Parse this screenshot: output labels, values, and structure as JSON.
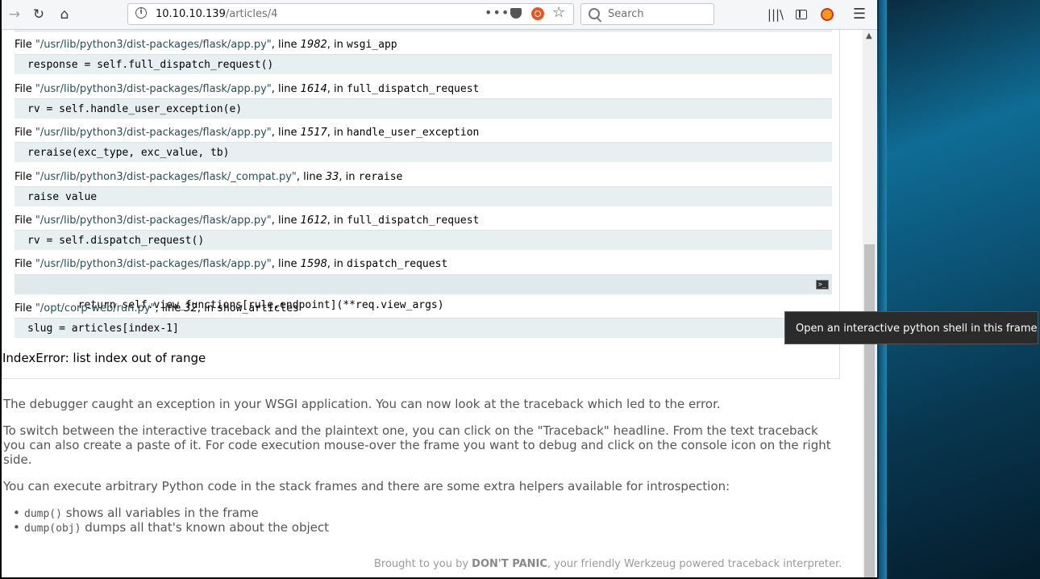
{
  "toolbar": {
    "url_host": "10.10.10.139",
    "url_path": "/articles/4",
    "more_label": "•••",
    "search_placeholder": "Search"
  },
  "frames": [
    {
      "prefix": "File ",
      "file": "\"/usr/lib/python3/dist-packages/flask/app.py\"",
      "mid": ", line ",
      "line": "1982",
      "post": ", in ",
      "func": "wsgi_app",
      "code": "response = self.full_dispatch_request()"
    },
    {
      "prefix": "File ",
      "file": "\"/usr/lib/python3/dist-packages/flask/app.py\"",
      "mid": ", line ",
      "line": "1614",
      "post": ", in ",
      "func": "full_dispatch_request",
      "code": "rv = self.handle_user_exception(e)"
    },
    {
      "prefix": "File ",
      "file": "\"/usr/lib/python3/dist-packages/flask/app.py\"",
      "mid": ", line ",
      "line": "1517",
      "post": ", in ",
      "func": "handle_user_exception",
      "code": "reraise(exc_type, exc_value, tb)"
    },
    {
      "prefix": "File ",
      "file": "\"/usr/lib/python3/dist-packages/flask/_compat.py\"",
      "mid": ", line ",
      "line": "33",
      "post": ", in ",
      "func": "reraise",
      "code": "raise value"
    },
    {
      "prefix": "File ",
      "file": "\"/usr/lib/python3/dist-packages/flask/app.py\"",
      "mid": ", line ",
      "line": "1612",
      "post": ", in ",
      "func": "full_dispatch_request",
      "code": "rv = self.dispatch_request()"
    },
    {
      "prefix": "File ",
      "file": "\"/usr/lib/python3/dist-packages/flask/app.py\"",
      "mid": ", line ",
      "line": "1598",
      "post": ", in ",
      "func": "dispatch_request",
      "code": "return self.view_functions[rule.endpoint](**req.view_args)"
    },
    {
      "prefix": "File ",
      "file": "\"/opt/corp-web/run.py\"",
      "mid": ", line ",
      "line": "32",
      "post": ", in ",
      "func": "show_articles",
      "code": "slug = articles[index-1]"
    }
  ],
  "console_icon": ">_",
  "exception": "IndexError: list index out of range",
  "explanation": {
    "p1": "The debugger caught an exception in your WSGI application. You can now look at the traceback which led to the error.",
    "p2": "To switch between the interactive traceback and the plaintext one, you can click on the \"Traceback\" headline. From the text traceback you can also create a paste of it. For code execution mouse-over the frame you want to debug and click on the console icon on the right side.",
    "p3": "You can execute arbitrary Python code in the stack frames and there are some extra helpers available for introspection:",
    "bullets": [
      {
        "code": "dump()",
        "text": " shows all variables in the frame"
      },
      {
        "code": "dump(obj)",
        "text": " dumps all that's known about the object"
      }
    ]
  },
  "footer": {
    "pre": "Brought to you by ",
    "brand": "DON'T PANIC",
    "post": ", your friendly Werkzeug powered traceback interpreter."
  },
  "tooltip": "Open an interactive python shell in this frame"
}
